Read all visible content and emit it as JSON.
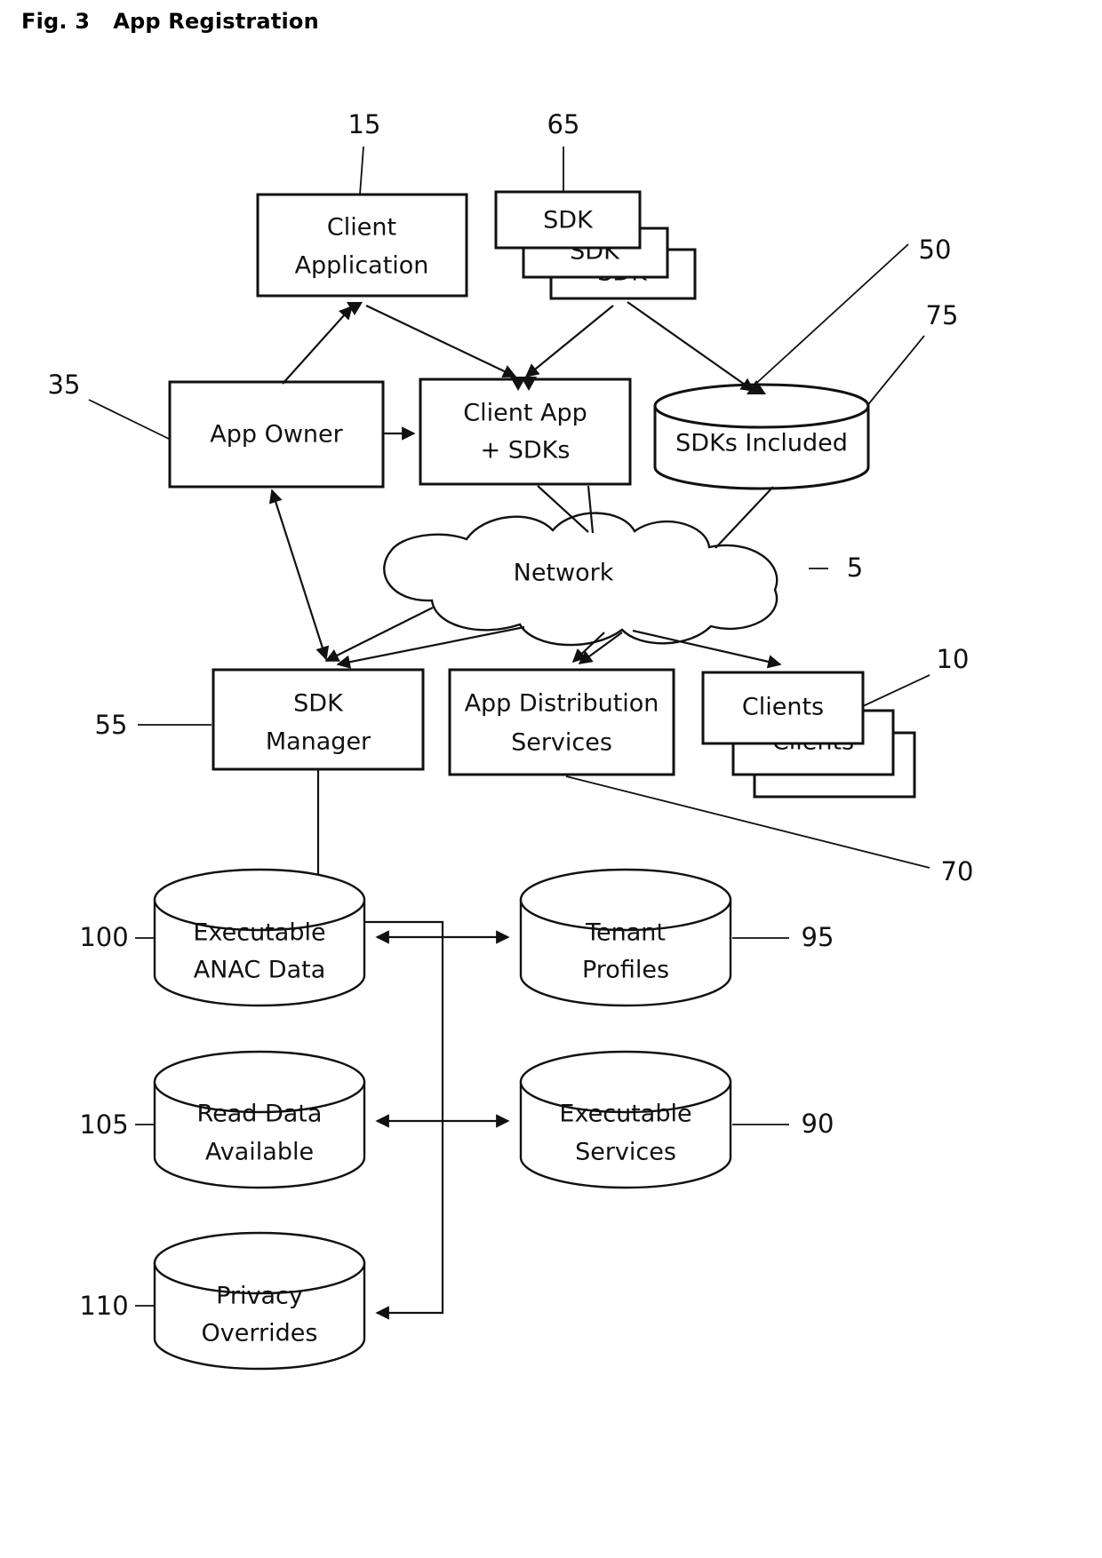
{
  "figure": {
    "number_label": "Fig. 3",
    "title": "App Registration"
  },
  "nodes": {
    "client_application": {
      "label_line1": "Client",
      "label_line2": "Application",
      "ref": "15",
      "shape": "box"
    },
    "sdk_stack": {
      "label_front": "SDK",
      "label_mid": "SDK",
      "label_back": "SDK",
      "ref": "65",
      "shape": "stacked-box"
    },
    "app_owner": {
      "label_line1": "App Owner",
      "label_line2": "",
      "ref": "35",
      "shape": "box"
    },
    "client_app_sdks": {
      "label_line1": "Client App",
      "label_line2": "+ SDKs",
      "ref": "50",
      "shape": "box"
    },
    "sdks_included": {
      "label_line1": "SDKs Included",
      "label_line2": "",
      "ref": "75",
      "shape": "cylinder"
    },
    "network": {
      "label_line1": "Network",
      "label_line2": "",
      "ref": "5",
      "shape": "cloud"
    },
    "sdk_manager": {
      "label_line1": "SDK",
      "label_line2": "Manager",
      "ref": "55",
      "shape": "box"
    },
    "app_distribution_services": {
      "label_line1": "App Distribution",
      "label_line2": "Services",
      "ref": "70",
      "shape": "box"
    },
    "clients": {
      "label_front": "Clients",
      "label_mid": "Clients",
      "label_back": "Clients",
      "ref": "10",
      "shape": "stacked-box"
    },
    "executable_anac_data": {
      "label_line1": "Executable",
      "label_line2": "ANAC Data",
      "ref": "100",
      "shape": "cylinder"
    },
    "tenant_profiles": {
      "label_line1": "Tenant",
      "label_line2": "Profiles",
      "ref": "95",
      "shape": "cylinder"
    },
    "read_data_available": {
      "label_line1": "Read Data",
      "label_line2": "Available",
      "ref": "105",
      "shape": "cylinder"
    },
    "executable_services": {
      "label_line1": "Executable",
      "label_line2": "Services",
      "ref": "90",
      "shape": "cylinder"
    },
    "privacy_overrides": {
      "label_line1": "Privacy",
      "label_line2": "Overrides",
      "ref": "110",
      "shape": "cylinder"
    }
  },
  "colors": {
    "ink": "#111111",
    "paper": "#ffffff"
  }
}
